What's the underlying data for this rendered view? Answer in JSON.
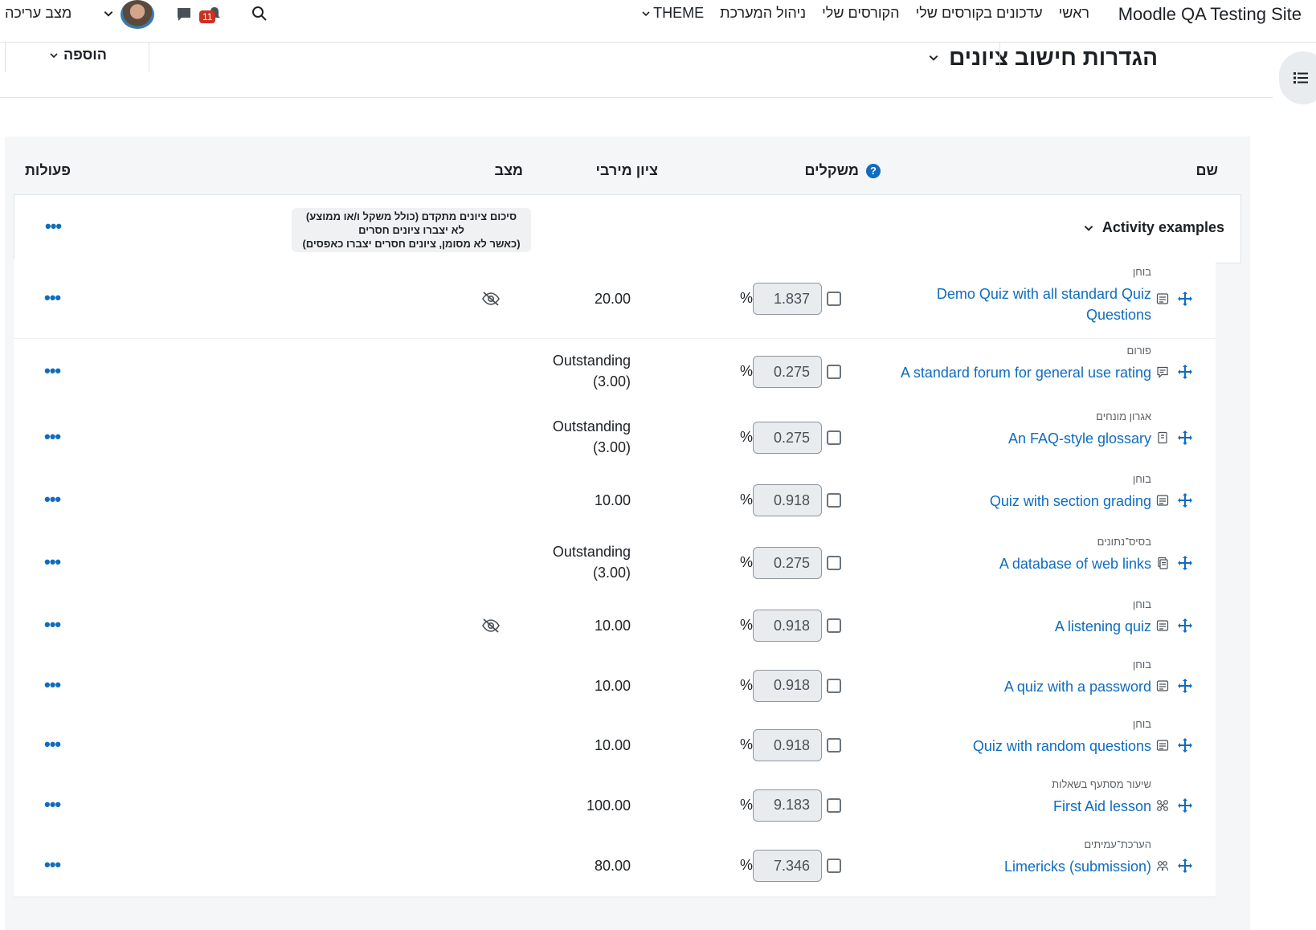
{
  "navbar": {
    "site_name": "Moodle QA Testing Site",
    "links": [
      "ראשי",
      "עדכונים בקורסים שלי",
      "הקורסים שלי",
      "ניהול המערכת"
    ],
    "theme_label": "THEME",
    "notification_count": "11",
    "edit_mode_label": "מצב עריכה"
  },
  "header": {
    "title": "הגדרות חישוב ציונים",
    "add_label": "הוספה"
  },
  "columns": {
    "name": "שם",
    "weights": "משקלים",
    "max_grade": "ציון מירבי",
    "status": "מצב",
    "actions": "פעולות",
    "help_glyph": "?"
  },
  "category": {
    "name": "Activity examples",
    "aggregation_line1": "סיכום ציונים מתקדם (כולל משקל ו/או ממוצע)",
    "aggregation_line2": "לא יצברו ציונים חסרים",
    "aggregation_line3": "(כאשר לא מסומן, ציונים חסרים יצברו כאפסים)",
    "actions_glyph": "•••"
  },
  "items": [
    {
      "type": "בוחן",
      "name": "Demo Quiz with all standard Quiz Questions",
      "weight": "1.837",
      "max_grade": "20.00",
      "hidden": true,
      "icon": "quiz-icon"
    },
    {
      "type": "פורום",
      "name": "A standard forum for general use rating",
      "weight": "0.275",
      "max_grade": "Outstanding (3.00)",
      "hidden": false,
      "icon": "forum-icon"
    },
    {
      "type": "אגרון מונחים",
      "name": "An FAQ-style glossary",
      "weight": "0.275",
      "max_grade": "Outstanding (3.00)",
      "hidden": false,
      "icon": "glossary-icon"
    },
    {
      "type": "בוחן",
      "name": "Quiz with section grading",
      "weight": "0.918",
      "max_grade": "10.00",
      "hidden": false,
      "icon": "quiz-icon"
    },
    {
      "type": "בסיס־נתונים",
      "name": "A database of web links",
      "weight": "0.275",
      "max_grade": "Outstanding (3.00)",
      "hidden": false,
      "icon": "database-icon"
    },
    {
      "type": "בוחן",
      "name": "A listening quiz",
      "weight": "0.918",
      "max_grade": "10.00",
      "hidden": true,
      "icon": "quiz-icon"
    },
    {
      "type": "בוחן",
      "name": "A quiz with a password",
      "weight": "0.918",
      "max_grade": "10.00",
      "hidden": false,
      "icon": "quiz-icon"
    },
    {
      "type": "בוחן",
      "name": "Quiz with random questions",
      "weight": "0.918",
      "max_grade": "10.00",
      "hidden": false,
      "icon": "quiz-icon"
    },
    {
      "type": "שיעור מסתעף בשאלות",
      "name": "First Aid lesson",
      "weight": "9.183",
      "max_grade": "100.00",
      "hidden": false,
      "icon": "lesson-icon"
    },
    {
      "type": "הערכת־עמיתים",
      "name": "Limericks (submission)",
      "weight": "7.346",
      "max_grade": "80.00",
      "hidden": false,
      "icon": "workshop-icon"
    }
  ],
  "percent_sign": "%",
  "actions_glyph": "•••"
}
